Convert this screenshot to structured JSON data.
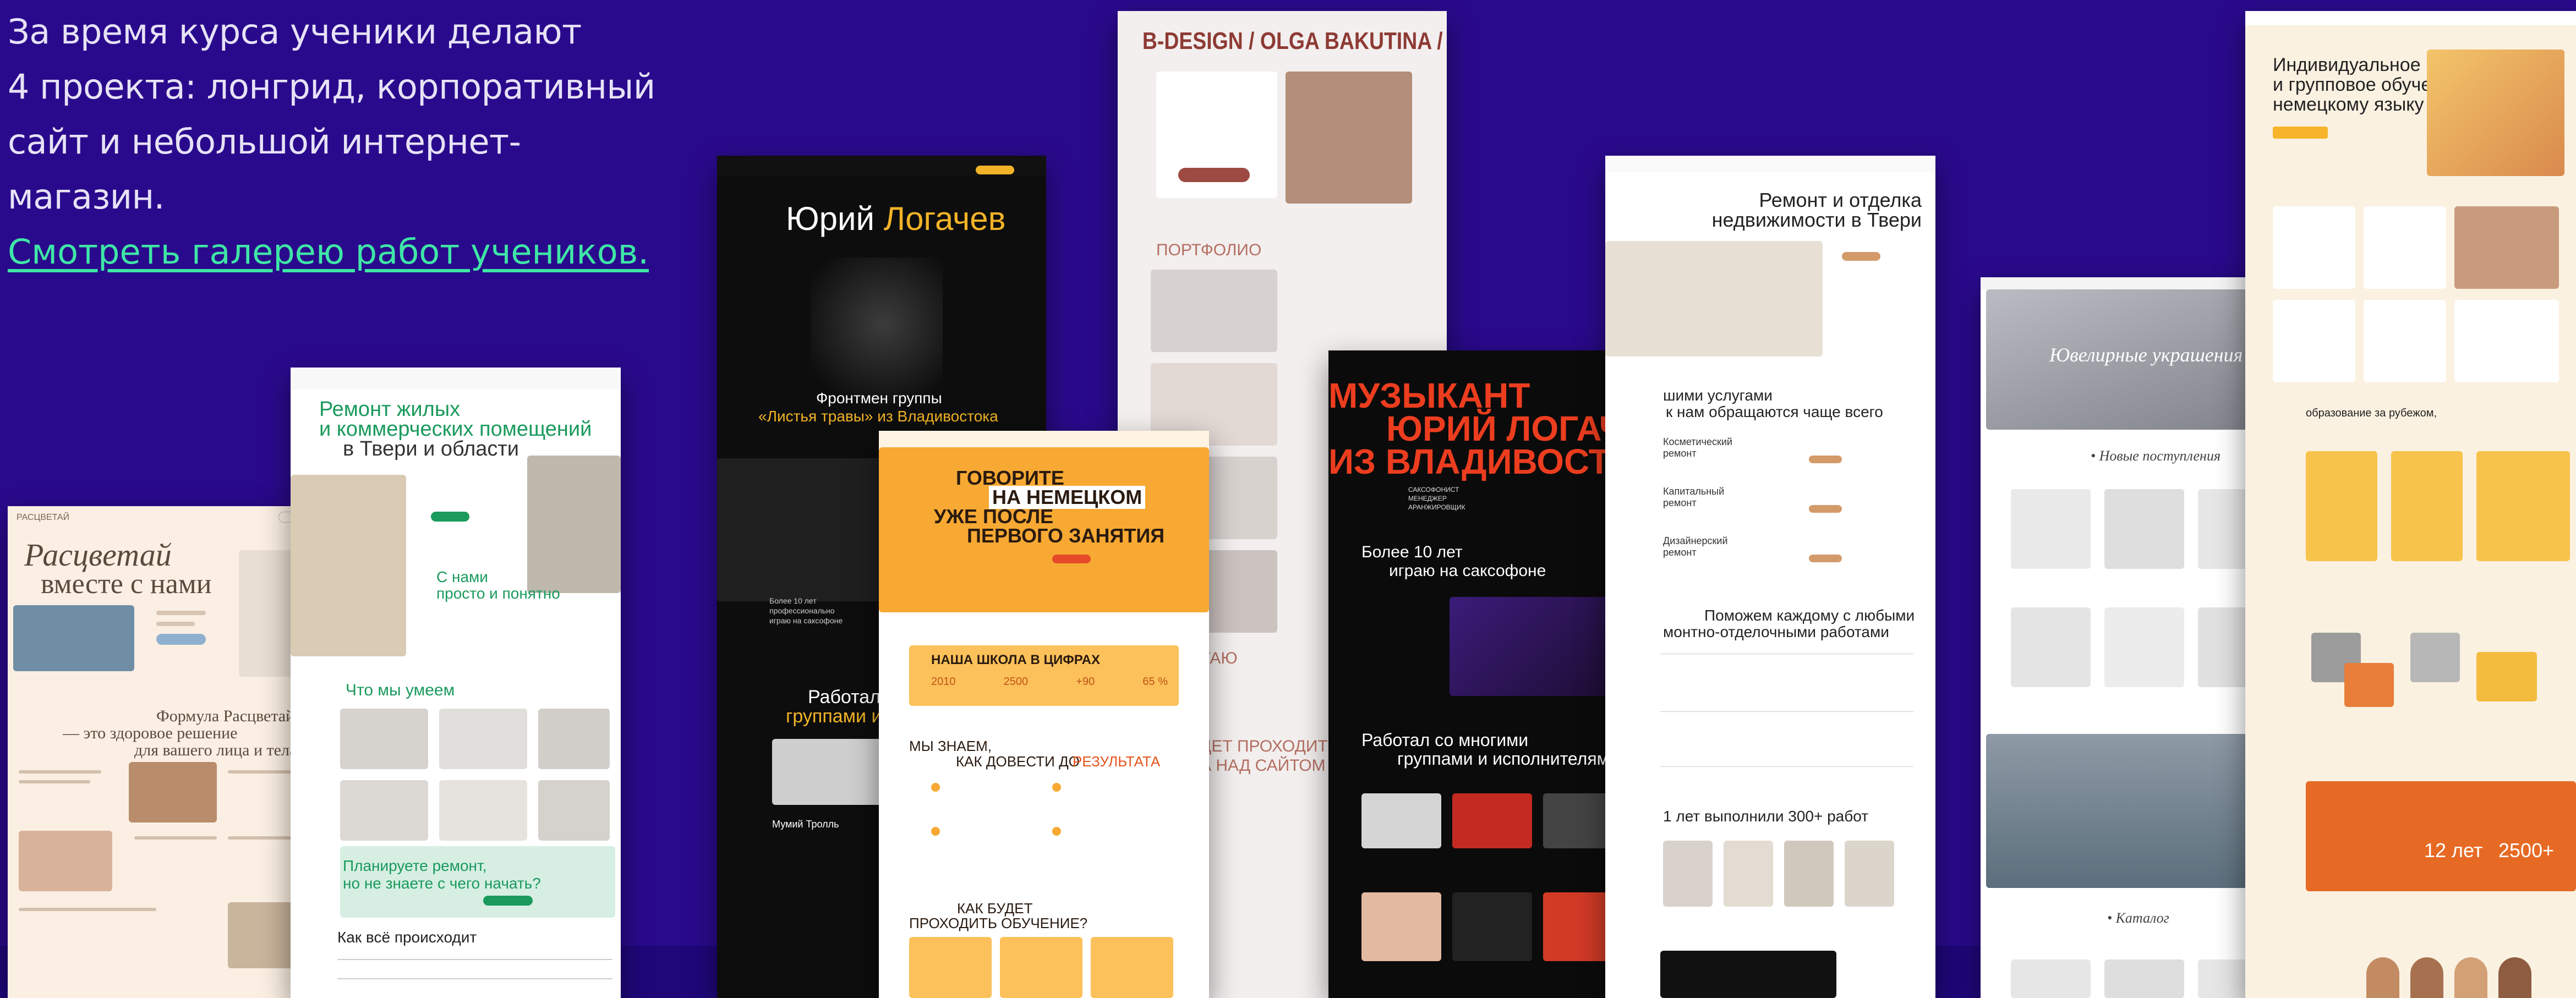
{
  "intro": {
    "line1": "За время курса ученики делают",
    "line2": "4 проекта: лонгрид, корпоративный",
    "line3": "сайт и небольшой интернет-магазин.",
    "link": "Смотреть галерею работ учеников."
  },
  "shots": {
    "rastsvetay": {
      "logo": "РАСЦВЕТАЙ",
      "title1": "Расцветай",
      "title2": "вместе с нами",
      "formula1": "Формула Расцветай",
      "formula2": "— это здоровое решение",
      "formula3": "для вашего лица и тела"
    },
    "remont_tver": {
      "title1": "Ремонт жилых",
      "title2": "и коммерческих помещений",
      "title3": "в Твери и области",
      "simple1": "С нами",
      "simple2": "просто и понятно",
      "what": "Что мы умеем",
      "plan1": "Планируете ремонт,",
      "plan2": "но не знаете с чего начать?",
      "how": "Как всё происходит"
    },
    "logachev_black": {
      "name1": "Юрий",
      "name2": "Логачев",
      "front1": "Фронтмен группы",
      "front2": "«Листья травы» из Владивостока",
      "more": "Более 10 лет профессионально играю на саксофоне",
      "worked1": "Работал с",
      "worked2": "группами и и",
      "troll": "Мумий Тролль"
    },
    "olga": {
      "header": "B-DESIGN / OLGA  BAKUTINA / TILDA",
      "portfolio": "ПОРТФОЛИО",
      "tayu": "ТАЮ",
      "prohodit1": "ДЕТ ПРОХОДИТЬ",
      "prohodit2": "А НАД САЙТОМ"
    },
    "nemetsky_school": {
      "h1": "ГОВОРИТЕ",
      "h2": "НА НЕМЕЦКОМ",
      "h3": "УЖЕ ПОСЛЕ",
      "h4": "ПЕРВОГО ЗАНЯТИЯ",
      "numbers": "НАША ШКОЛА В ЦИФРАХ",
      "stats": [
        "2010",
        "2500",
        "+90",
        "65 %"
      ],
      "know1": "МЫ ЗНАЕМ,",
      "know2": "КАК ДОВЕСТИ ДО",
      "know3": "РЕЗУЛЬТАТА",
      "how1": "КАК БУДЕТ",
      "how2": "ПРОХОДИТЬ ОБУЧЕНИЕ?"
    },
    "muzykant": {
      "t1": "МУЗЫКАНТ",
      "t2": "ЮРИЙ ЛОГАЧЕВ",
      "t3": "ИЗ ВЛАДИВОСТОКА",
      "tags": "САКСОФОНИСТ\nМЕНЕДЖЕР\nАРАНЖИРОВЩИК",
      "more1": "Более 10 лет",
      "more2": "играю на саксофоне",
      "worked1": "Работал со многими",
      "worked2": "группами и исполнителями"
    },
    "remont_realty": {
      "title1": "Ремонт и отделка",
      "title2": "недвижимости в Твери",
      "services1": "шими услугами",
      "services2": "к нам обращаются чаще всего",
      "s1": "Косметический ремонт",
      "s2": "Капитальный ремонт",
      "s3": "Дизайнерский ремонт",
      "help1": "Поможем каждому с любыми",
      "help2": "монтно-отделочными работами",
      "done": "1 лет выполнили 300+ работ"
    },
    "jewelry": {
      "hero": "Ювелирные украшения",
      "new": "• Новые поступления",
      "catalog": "• Каталог"
    },
    "german_individual": {
      "title1": "Индивидуальное",
      "title2": "и групповое обучение",
      "title3": "немецкому языку",
      "edu": "образование за рубежом,",
      "years": "12 лет",
      "count": "2500+"
    }
  },
  "colors": {
    "bg": "#2a0a8c",
    "link": "#3ee6a6",
    "orange": "#f7a933",
    "red": "#e63a1e",
    "green": "#1a9a5c"
  }
}
